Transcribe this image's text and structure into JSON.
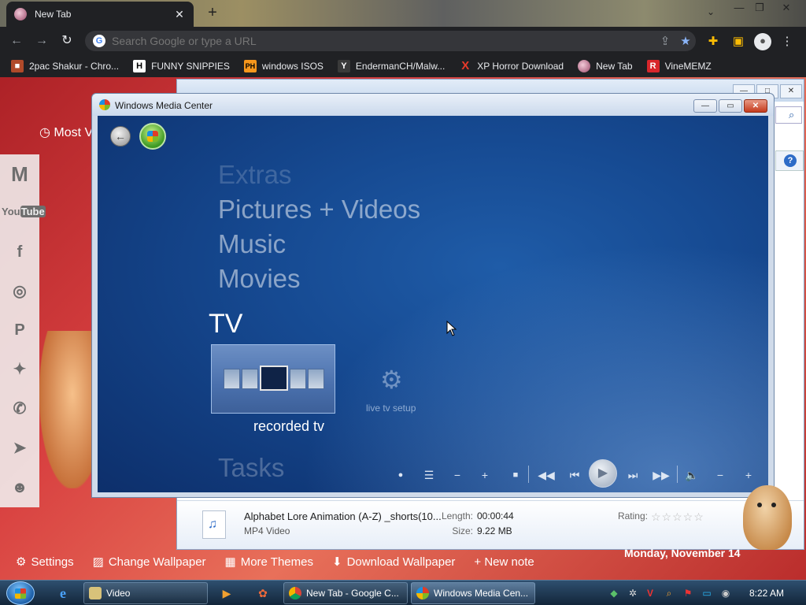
{
  "browser": {
    "tab_title": "New Tab",
    "tab_close": "✕",
    "new_tab": "+",
    "omnibox_placeholder": "Search Google or type a URL",
    "bookmarks": [
      {
        "label": "2pac Shakur - Chro...",
        "icon": "2pac-favicon"
      },
      {
        "label": "FUNNY SNIPPIES",
        "icon": "H"
      },
      {
        "label": "windows ISOS",
        "icon": "PH"
      },
      {
        "label": "EndermanCH/Malw...",
        "icon": "Y"
      },
      {
        "label": "XP Horror Download",
        "icon": "X"
      },
      {
        "label": "New Tab",
        "icon": "newtab-favicon"
      },
      {
        "label": "VineMEMZ",
        "icon": "R"
      }
    ]
  },
  "ntp": {
    "most_visited": "Most V",
    "bottom": {
      "settings": "Settings",
      "change_wallpaper": "Change Wallpaper",
      "more_themes": "More Themes",
      "download_wallpaper": "Download Wallpaper",
      "new_note": "+ New note"
    },
    "date": "Monday, November 14"
  },
  "explorer": {
    "file_name": "Alphabet Lore Animation (A-Z) _shorts(10...",
    "file_type": "MP4 Video",
    "length_label": "Length:",
    "length_value": "00:00:44",
    "size_label": "Size:",
    "size_value": "9.22 MB",
    "rating_label": "Rating:",
    "rating_stars": "☆☆☆☆☆"
  },
  "wmc": {
    "title": "Windows Media Center",
    "menu": {
      "extras": "Extras",
      "pictures": "Pictures + Videos",
      "music": "Music",
      "movies": "Movies",
      "tv": "TV",
      "tasks": "Tasks"
    },
    "tile_label": "recorded tv",
    "setup_label": "live tv setup"
  },
  "taskbar": {
    "items": [
      {
        "label": "Video"
      },
      {
        "label": "New Tab - Google C..."
      },
      {
        "label": "Windows Media Cen..."
      }
    ],
    "clock": "8:22 AM"
  },
  "colors": {
    "wmc_blue": "#164a92",
    "chrome_dark": "#202124",
    "ntp_red": "#d84040"
  }
}
